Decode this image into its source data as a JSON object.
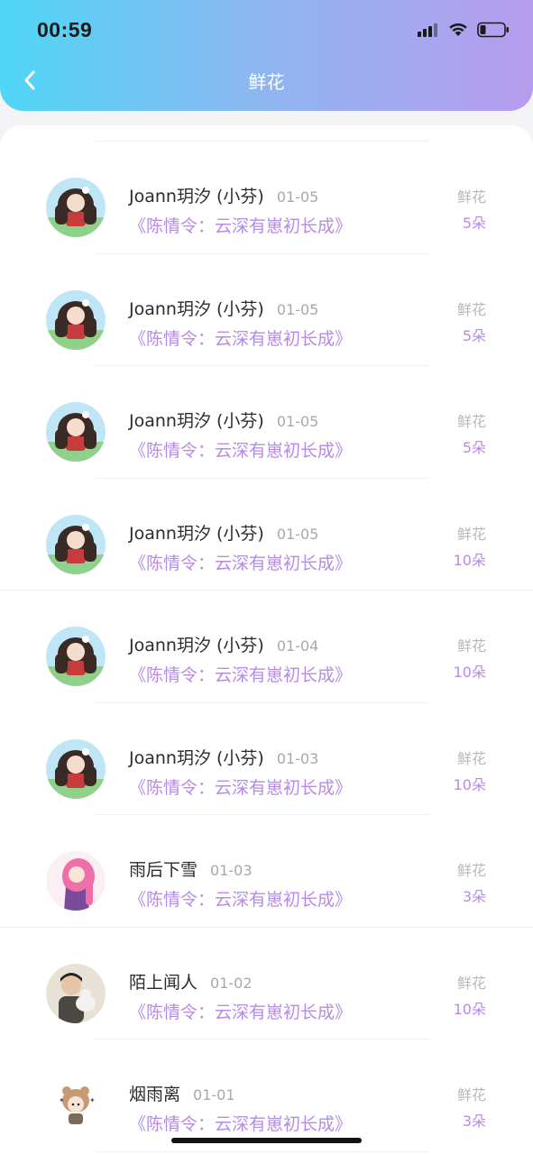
{
  "status_bar": {
    "time": "00:59"
  },
  "nav": {
    "title": "鲜花"
  },
  "records": [
    {
      "name": "Joann玥汐 (小芬)",
      "date": "01-05",
      "book": "《陈情令：云深有崽初长成》",
      "gift_label": "鲜花",
      "gift_count": "5朵",
      "avatar": "anime-avatar-icon"
    },
    {
      "name": "Joann玥汐 (小芬)",
      "date": "01-05",
      "book": "《陈情令：云深有崽初长成》",
      "gift_label": "鲜花",
      "gift_count": "5朵",
      "avatar": "anime-avatar-icon"
    },
    {
      "name": "Joann玥汐 (小芬)",
      "date": "01-05",
      "book": "《陈情令：云深有崽初长成》",
      "gift_label": "鲜花",
      "gift_count": "5朵",
      "avatar": "anime-avatar-icon"
    },
    {
      "name": "Joann玥汐 (小芬)",
      "date": "01-05",
      "book": "《陈情令：云深有崽初长成》",
      "gift_label": "鲜花",
      "gift_count": "10朵",
      "avatar": "anime-avatar-icon"
    },
    {
      "name": "Joann玥汐 (小芬)",
      "date": "01-04",
      "book": "《陈情令：云深有崽初长成》",
      "gift_label": "鲜花",
      "gift_count": "10朵",
      "avatar": "anime-avatar-icon"
    },
    {
      "name": "Joann玥汐 (小芬)",
      "date": "01-03",
      "book": "《陈情令：云深有崽初长成》",
      "gift_label": "鲜花",
      "gift_count": "10朵",
      "avatar": "anime-avatar-icon"
    },
    {
      "name": "雨后下雪",
      "date": "01-03",
      "book": "《陈情令：云深有崽初长成》",
      "gift_label": "鲜花",
      "gift_count": "3朵",
      "avatar": "pink-hair-avatar-icon"
    },
    {
      "name": "陌上闻人",
      "date": "01-02",
      "book": "《陈情令：云深有崽初长成》",
      "gift_label": "鲜花",
      "gift_count": "10朵",
      "avatar": "person-with-cat-avatar-icon"
    },
    {
      "name": "烟雨离",
      "date": "01-01",
      "book": "《陈情令：云深有崽初长成》",
      "gift_label": "鲜花",
      "gift_count": "3朵",
      "avatar": "bear-hat-avatar-icon"
    }
  ],
  "colors": {
    "accent": "#b78be4",
    "header_start": "#4fd6f6",
    "header_end": "#b79cee"
  }
}
